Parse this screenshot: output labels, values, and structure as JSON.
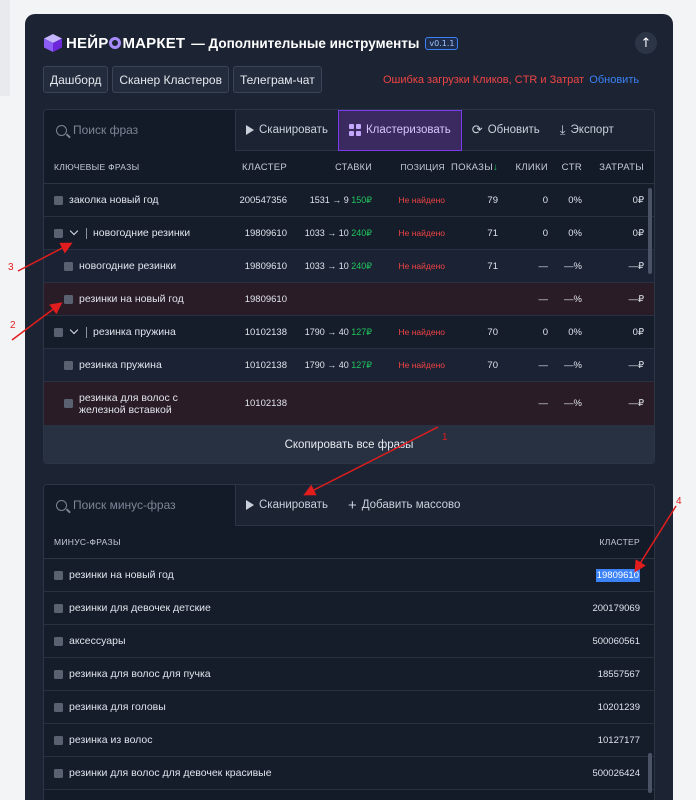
{
  "header": {
    "brand_left": "НЕЙР",
    "brand_right": "МАРКЕТ",
    "subtitle": "— Дополнительные инструменты",
    "version": "v0.1.1"
  },
  "nav": [
    "Дашборд",
    "Сканер Кластеров",
    "Телеграм-чат"
  ],
  "error": {
    "text": "Ошибка загрузки Кликов, CTR и Затрат",
    "action": "Обновить"
  },
  "phrases_toolbar": {
    "search_placeholder": "Поиск фраз",
    "scan": "Сканировать",
    "cluster": "Кластеризовать",
    "refresh": "Обновить",
    "export": "Экспорт"
  },
  "phrases_table": {
    "headers": [
      "КЛЮЧЕВЫЕ ФРАЗЫ",
      "КЛАСТЕР",
      "СТАВКИ",
      "ПОЗИЦИЯ",
      "ПОКАЗЫ",
      "КЛИКИ",
      "CTR",
      "ЗАТРАТЫ"
    ],
    "sort_arrow": "↓",
    "rows": [
      {
        "phrase": "заколка новый год",
        "cluster": "200547356",
        "bid": "1531 → 9 ",
        "bid_price": "150₽",
        "position": "Не найдено",
        "shows": "79",
        "clicks": "0",
        "ctr": "0%",
        "cost": "0₽"
      },
      {
        "phrase": "новогодние резинки",
        "cluster": "19809610",
        "bid": "1033 → 10 ",
        "bid_price": "240₽",
        "position": "Не найдено",
        "shows": "71",
        "clicks": "0",
        "ctr": "0%",
        "cost": "0₽"
      },
      {
        "phrase": "новогодние резинки",
        "cluster": "19809610",
        "bid": "1033 → 10 ",
        "bid_price": "240₽",
        "position": "Не найдено",
        "shows": "71",
        "clicks": "—",
        "ctr": "—%",
        "cost": "—₽"
      },
      {
        "phrase": "резинки на новый год",
        "cluster": "19809610",
        "bid": "",
        "bid_price": "",
        "position": "",
        "shows": "",
        "clicks": "—",
        "ctr": "—%",
        "cost": "—₽"
      },
      {
        "phrase": "резинка пружина",
        "cluster": "10102138",
        "bid": "1790 → 40 ",
        "bid_price": "127₽",
        "position": "Не найдено",
        "shows": "70",
        "clicks": "0",
        "ctr": "0%",
        "cost": "0₽"
      },
      {
        "phrase": "резинка пружина",
        "cluster": "10102138",
        "bid": "1790 → 40 ",
        "bid_price": "127₽",
        "position": "Не найдено",
        "shows": "70",
        "clicks": "—",
        "ctr": "—%",
        "cost": "—₽"
      },
      {
        "phrase": "резинка для волос с железной вставкой",
        "cluster": "10102138",
        "bid": "",
        "bid_price": "",
        "position": "",
        "shows": "",
        "clicks": "—",
        "ctr": "—%",
        "cost": "—₽"
      }
    ],
    "copy_all": "Скопировать все фразы"
  },
  "minus_toolbar": {
    "search_placeholder": "Поиск минус-фраз",
    "scan": "Сканировать",
    "add_bulk": "Добавить массово"
  },
  "minus_table": {
    "headers": [
      "МИНУС-ФРАЗЫ",
      "КЛАСТЕР"
    ],
    "rows": [
      {
        "phrase": "резинки на новый год",
        "cluster": "19809610"
      },
      {
        "phrase": "резинки для девочек детские",
        "cluster": "200179069"
      },
      {
        "phrase": "аксессуары",
        "cluster": "500060561"
      },
      {
        "phrase": "резинка для волос для пучка",
        "cluster": "18557567"
      },
      {
        "phrase": "резинка для головы",
        "cluster": "10201239"
      },
      {
        "phrase": "резинка из волос",
        "cluster": "10127177"
      },
      {
        "phrase": "резинки для волос для девочек красивые",
        "cluster": "500026424"
      }
    ]
  },
  "annotations": [
    "1",
    "2",
    "3",
    "4"
  ],
  "colors": {
    "panel": "#1c2433",
    "accent": "#7c3aed",
    "error": "#ef4444",
    "green": "#22c55e",
    "link": "#3b82f6",
    "annotation": "#e11d1d"
  }
}
